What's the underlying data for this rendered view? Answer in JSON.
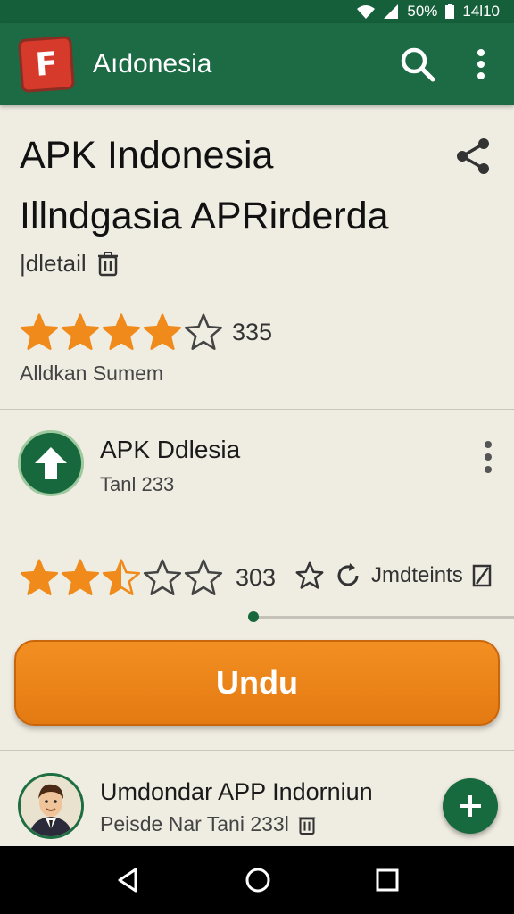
{
  "status_bar": {
    "battery": "50%",
    "time": "14l10"
  },
  "app_bar": {
    "logo_letter": "F",
    "title": "Aıdonesia"
  },
  "header": {
    "title_line1": "APK Indonesia",
    "title_line2": "Illndgasia APRirderda",
    "detail": "|dletail",
    "rating": 4,
    "rating_count": "335",
    "summary": "Alldkan Sumem"
  },
  "app_card": {
    "name": "APK Ddlesia",
    "sub": "Tanl 233",
    "rating": 2.5,
    "rating_count": "303",
    "action_label": "Jmdteints",
    "progress": 0.0
  },
  "download": {
    "label": "Undu"
  },
  "list_item": {
    "title": "Umdondar APP Indorniun",
    "sub": "Peisde Nar Tani 233l"
  },
  "colors": {
    "primary": "#1c6b45",
    "accent": "#e47a12",
    "star": "#f08a1a"
  }
}
